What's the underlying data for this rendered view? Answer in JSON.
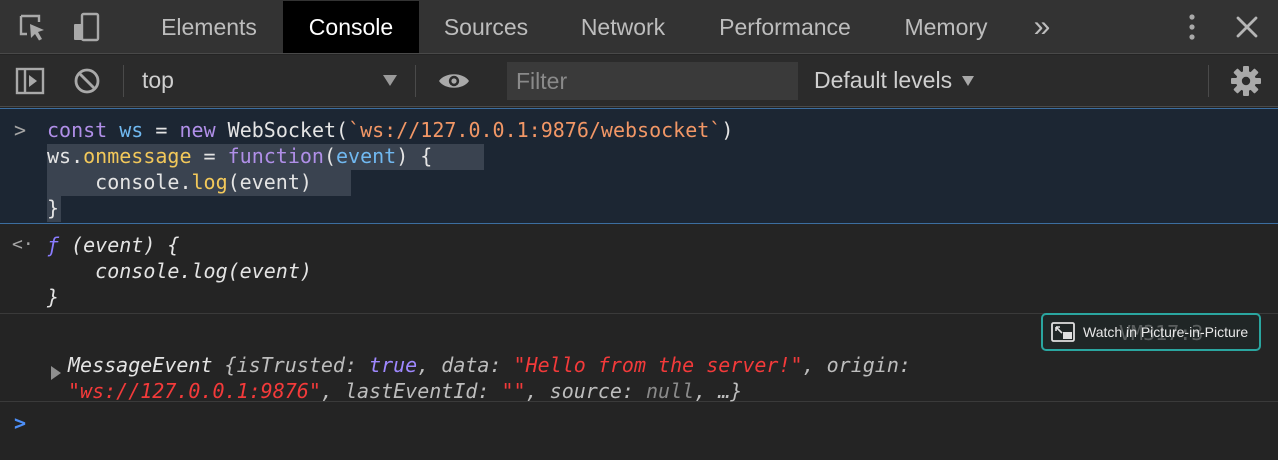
{
  "tabs": {
    "items": [
      {
        "label": "Elements"
      },
      {
        "label": "Console"
      },
      {
        "label": "Sources"
      },
      {
        "label": "Network"
      },
      {
        "label": "Performance"
      },
      {
        "label": "Memory"
      }
    ],
    "active": "Console",
    "overflow_glyph": "»",
    "close_glyph": "✕"
  },
  "toolbar": {
    "context": "top",
    "filter_placeholder": "Filter",
    "levels_label": "Default levels"
  },
  "console": {
    "input": {
      "prompt": ">",
      "l1": {
        "kw1": "const",
        "var1": "ws",
        "eq": " = ",
        "kw2": "new",
        "ctor": " WebSocket(",
        "str": "`ws://127.0.0.1:9876/websocket`",
        "close": ")"
      },
      "l2": {
        "obj": "ws.",
        "prop": "onmessage",
        "eq": " = ",
        "kw": "function",
        "open": "(",
        "arg": "event",
        "close": ") {"
      },
      "l3": {
        "obj": "    console.",
        "fn": "log",
        "rest": "(event)"
      },
      "l4": "}"
    },
    "result": {
      "prompt": "<·",
      "l1": {
        "f": "ƒ",
        "rest": " (event) {"
      },
      "l2": "    console.log(event)",
      "l3": "}"
    },
    "message": {
      "name": "MessageEvent",
      "open": " {",
      "k1": "isTrusted: ",
      "v1": "true",
      "k2": ", data: ",
      "v2": "\"Hello from the server!\"",
      "k3": ", origin:",
      "v3": "\"ws://127.0.0.1:9876\"",
      "k4": ", lastEventId: ",
      "v4": "\"\"",
      "k5": ", source: ",
      "v5": "null",
      "end": ", …}",
      "source_link": "VM317:3"
    },
    "pip_label": "Watch in Picture-in-Picture",
    "prompt": ">"
  }
}
